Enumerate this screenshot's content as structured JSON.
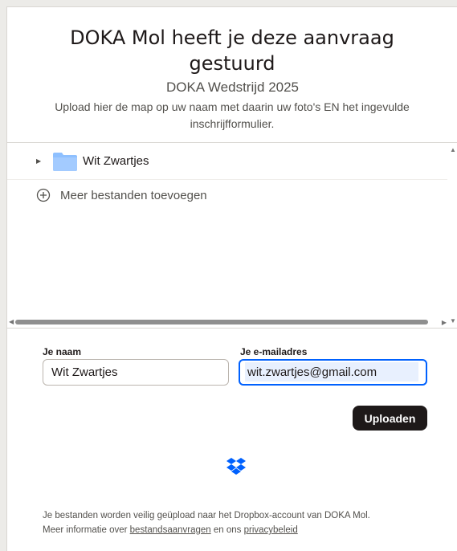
{
  "header": {
    "title": "DOKA Mol heeft je deze aanvraag gestuurd",
    "subtitle": "DOKA Wedstrijd 2025",
    "description": "Upload hier de map op uw naam met daarin uw foto's EN het ingevulde inschrijfformulier."
  },
  "files": {
    "items": [
      {
        "name": "Wit Zwartjes",
        "icon": "folder-icon"
      }
    ],
    "add_label": "Meer bestanden toevoegen"
  },
  "form": {
    "name_label": "Je naam",
    "name_value": "Wit Zwartjes",
    "email_label": "Je e-mailadres",
    "email_value": "wit.zwartjes@gmail.com",
    "upload_label": "Uploaden"
  },
  "footer": {
    "line1": "Je bestanden worden veilig geüpload naar het Dropbox-account van DOKA Mol.",
    "line2_prefix": "Meer informatie over ",
    "link1": "bestandsaanvragen",
    "line2_middle": " en ons ",
    "link2": "privacybeleid"
  },
  "colors": {
    "accent": "#0061fe",
    "folder": "#8ec0ff",
    "button": "#1e1919",
    "dropbox": "#0061fe"
  }
}
